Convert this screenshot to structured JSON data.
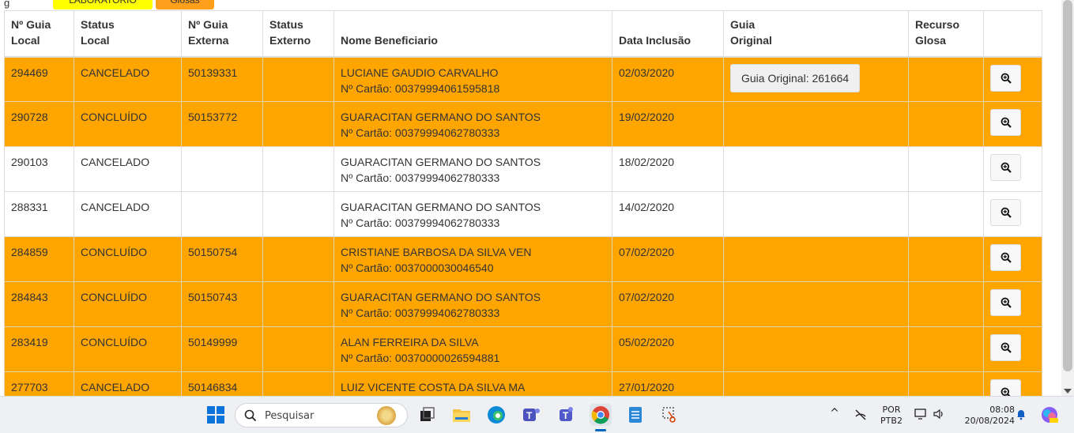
{
  "topbar": {
    "label": "g",
    "yellow_button": "LABORATORIO",
    "orange_button": "Glosas"
  },
  "table": {
    "headers": [
      {
        "line1": "Nº Guia",
        "line2": "Local"
      },
      {
        "line1": "Status",
        "line2": "Local"
      },
      {
        "line1": "Nº Guia",
        "line2": "Externa"
      },
      {
        "line1": "Status",
        "line2": "Externo"
      },
      {
        "line1": "",
        "line2": "Nome Beneficiario"
      },
      {
        "line1": "",
        "line2": "Data Inclusão"
      },
      {
        "line1": "Guia",
        "line2": "Original"
      },
      {
        "line1": "Recurso",
        "line2": "Glosa"
      },
      {
        "line1": "",
        "line2": ""
      }
    ],
    "card_prefix": "Nº Cartão: ",
    "rows": [
      {
        "guia_local": "294469",
        "status_local": "CANCELADO",
        "guia_externa": "50139331",
        "status_externo": "",
        "nome": "LUCIANE GAUDIO CARVALHO",
        "cartao": "Nº Cartão: 00379994061595818",
        "data": "02/03/2020",
        "guia_original": "Guia Original: 261664",
        "recurso": "",
        "color": "orange"
      },
      {
        "guia_local": "290728",
        "status_local": "CONCLUÍDO",
        "guia_externa": "50153772",
        "status_externo": "",
        "nome": "GUARACITAN GERMANO DO SANTOS",
        "cartao": "Nº Cartão: 00379994062780333",
        "data": "19/02/2020",
        "guia_original": "",
        "recurso": "",
        "color": "orange"
      },
      {
        "guia_local": "290103",
        "status_local": "CANCELADO",
        "guia_externa": "",
        "status_externo": "",
        "nome": "GUARACITAN GERMANO DO SANTOS",
        "cartao": "Nº Cartão: 00379994062780333",
        "data": "18/02/2020",
        "guia_original": "",
        "recurso": "",
        "color": "white"
      },
      {
        "guia_local": "288331",
        "status_local": "CANCELADO",
        "guia_externa": "",
        "status_externo": "",
        "nome": "GUARACITAN GERMANO DO SANTOS",
        "cartao": "Nº Cartão: 00379994062780333",
        "data": "14/02/2020",
        "guia_original": "",
        "recurso": "",
        "color": "white"
      },
      {
        "guia_local": "284859",
        "status_local": "CONCLUÍDO",
        "guia_externa": "50150754",
        "status_externo": "",
        "nome": "CRISTIANE BARBOSA DA SILVA VEN",
        "cartao": "Nº Cartão: 0037000030046540",
        "data": "07/02/2020",
        "guia_original": "",
        "recurso": "",
        "color": "orange"
      },
      {
        "guia_local": "284843",
        "status_local": "CONCLUÍDO",
        "guia_externa": "50150743",
        "status_externo": "",
        "nome": "GUARACITAN GERMANO DO SANTOS",
        "cartao": "Nº Cartão: 00379994062780333",
        "data": "07/02/2020",
        "guia_original": "",
        "recurso": "",
        "color": "orange"
      },
      {
        "guia_local": "283419",
        "status_local": "CONCLUÍDO",
        "guia_externa": "50149999",
        "status_externo": "",
        "nome": "ALAN FERREIRA DA SILVA",
        "cartao": "Nº Cartão: 00370000026594881",
        "data": "05/02/2020",
        "guia_original": "",
        "recurso": "",
        "color": "orange"
      },
      {
        "guia_local": "277703",
        "status_local": "CANCELADO",
        "guia_externa": "50146834",
        "status_externo": "",
        "nome": "LUIZ VICENTE COSTA DA SILVA MA",
        "cartao": "",
        "data": "27/01/2020",
        "guia_original": "",
        "recurso": "",
        "color": "orange"
      }
    ]
  },
  "taskbar": {
    "search_placeholder": "Pesquisar",
    "lang_line1": "POR",
    "lang_line2": "PTB2",
    "time": "08:08",
    "date": "20/08/2024",
    "icons": [
      "windows-start-icon",
      "task-view-icon",
      "file-explorer-icon",
      "edge-icon",
      "teams-icon",
      "teams-work-icon",
      "chrome-icon",
      "notepad-icon",
      "snipping-tool-icon"
    ]
  },
  "colors": {
    "row_orange": "#ffa500",
    "yellow_button": "#ffff00",
    "orange_button": "#ff9f1a"
  }
}
